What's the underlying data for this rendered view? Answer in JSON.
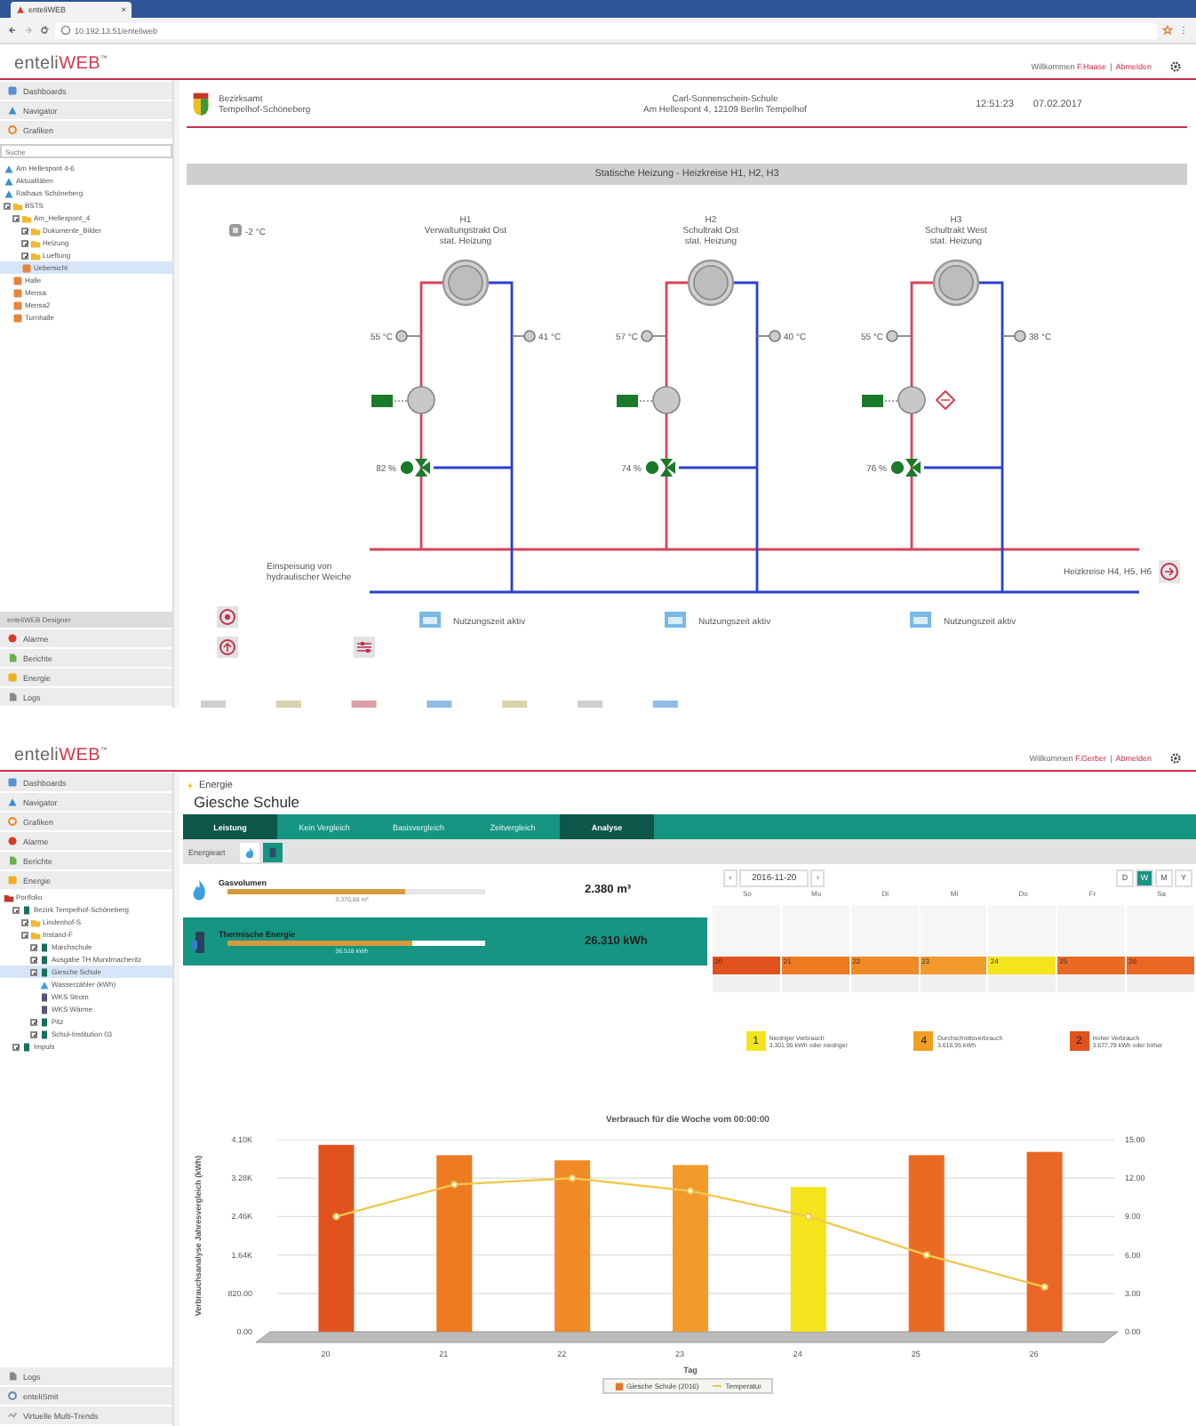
{
  "browser": {
    "tab_title": "enteliWEB",
    "tab_close": "×",
    "url": "10.192.13.51/enteliweb"
  },
  "top_app": {
    "logo": {
      "brand": "enteli",
      "accent": "WEB",
      "mark": "™"
    },
    "user_bar": {
      "greeting": "Willkommen",
      "user": "F.Haase",
      "separator": "|",
      "logout": "Abmelden"
    },
    "sidebar": {
      "nav": [
        {
          "label": "Dashboards",
          "kind": "dashboards"
        },
        {
          "label": "Navigator",
          "kind": "navigator"
        },
        {
          "label": "Grafiken",
          "kind": "graphics"
        }
      ],
      "search": {
        "placeholder": "Suche"
      },
      "tree": [
        {
          "label": "Am Hellespont 4-6",
          "kind": "site",
          "selected": false
        },
        {
          "label": "Aktualitäten",
          "kind": "site",
          "selected": false
        },
        {
          "label": "Rathaus Schöneberg",
          "kind": "site",
          "selected": false
        },
        {
          "label": "BSTS",
          "kind": "folder",
          "expanded": true,
          "selected": false,
          "children": [
            {
              "label": "Am_Hellespont_4",
              "kind": "folder",
              "expanded": true,
              "selected": false,
              "children": [
                {
                  "label": "Dokumente_Bilder",
                  "kind": "folder",
                  "expanded": false,
                  "selected": false
                },
                {
                  "label": "Heizung",
                  "kind": "folder",
                  "expanded": false,
                  "selected": false
                },
                {
                  "label": "Lueftung",
                  "kind": "folder",
                  "expanded": false,
                  "selected": false
                },
                {
                  "label": "Uebersicht",
                  "kind": "graphic",
                  "selected": true
                }
              ]
            },
            {
              "label": "Halle",
              "kind": "graphic",
              "selected": false
            },
            {
              "label": "Mensa",
              "kind": "graphic",
              "selected": false
            },
            {
              "label": "Mensa2",
              "kind": "graphic",
              "selected": false
            },
            {
              "label": "Turnhalle",
              "kind": "graphic",
              "selected": false
            }
          ]
        }
      ],
      "bottom_header": "enteliWEB Designer",
      "bottom_nav": [
        {
          "label": "Alarme",
          "kind": "alarms"
        },
        {
          "label": "Berichte",
          "kind": "reports"
        },
        {
          "label": "Energie",
          "kind": "energy"
        },
        {
          "label": "Logs",
          "kind": "logs"
        }
      ]
    },
    "site_header": {
      "authority": [
        "Bezirksamt",
        "Tempelhof-Schöneberg"
      ],
      "school": "Carl-Sonnenschein-Schule",
      "address": "Am Hellespont 4, 12109 Berlin Tempelhof",
      "time": "12:51:23",
      "date": "07.02.2017"
    },
    "diagram": {
      "title": "Statische Heizung - Heizkreise H1, H2, H3",
      "outside_temp": "-2 °C",
      "circuits": [
        {
          "id": "H1",
          "name": "Verwaltungstrakt Ost",
          "type": "stat. Heizung",
          "supply_temp": "55 °C",
          "return_temp": "41 °C",
          "valve": "82 %",
          "fault": false,
          "usage": "Nutzungszeit aktiv"
        },
        {
          "id": "H2",
          "name": "Schultrakt Ost",
          "type": "stat. Heizung",
          "supply_temp": "57 °C",
          "return_temp": "40 °C",
          "valve": "74 %",
          "fault": false,
          "usage": "Nutzungszeit aktiv"
        },
        {
          "id": "H3",
          "name": "Schultrakt West",
          "type": "stat. Heizung",
          "supply_temp": "55 °C",
          "return_temp": "38 °C",
          "valve": "76 %",
          "fault": true,
          "usage": "Nutzungszeit aktiv"
        }
      ],
      "feed_label": [
        "Einspeisung von",
        "hydraulischer Weiche"
      ],
      "next_label": "Heizkreise H4, H5, H6"
    }
  },
  "bottom_app": {
    "logo": {
      "brand": "enteli",
      "accent": "WEB",
      "mark": "™"
    },
    "user_bar": {
      "greeting": "Willkommen",
      "user": "F.Gerber",
      "separator": "|",
      "logout": "Abmelden"
    },
    "sidebar": {
      "nav": [
        {
          "label": "Dashboards",
          "kind": "dashboards"
        },
        {
          "label": "Navigator",
          "kind": "navigator"
        },
        {
          "label": "Grafiken",
          "kind": "graphics"
        },
        {
          "label": "Alarme",
          "kind": "alarms"
        },
        {
          "label": "Berichte",
          "kind": "reports"
        },
        {
          "label": "Energie",
          "kind": "energy"
        }
      ],
      "tree": [
        {
          "label": "Portfolio",
          "kind": "portfolio",
          "selected": false,
          "children": [
            {
              "label": "Bezirk Tempelhof-Schöneberg",
              "kind": "building",
              "expanded": true,
              "selected": false,
              "children": [
                {
                  "label": "Lindenhof-S",
                  "kind": "folder",
                  "expanded": false,
                  "selected": false
                },
                {
                  "label": "Instand-F",
                  "kind": "folder",
                  "expanded": true,
                  "selected": false,
                  "children": [
                    {
                      "label": "Marchschule",
                      "kind": "building",
                      "expanded": false,
                      "selected": false
                    },
                    {
                      "label": "Ausgabe TH Mundmacheritz",
                      "kind": "building",
                      "expanded": false,
                      "selected": false
                    },
                    {
                      "label": "Giesche Schule",
                      "kind": "building",
                      "expanded": true,
                      "selected": true,
                      "children": [
                        {
                          "label": "Wasserzähler (kWh)",
                          "kind": "gas",
                          "selected": false
                        },
                        {
                          "label": "WKS Strom",
                          "kind": "meter",
                          "selected": false
                        },
                        {
                          "label": "WKS Wärme",
                          "kind": "meter",
                          "selected": false
                        }
                      ]
                    },
                    {
                      "label": "Pitz",
                      "kind": "building",
                      "expanded": false,
                      "selected": false
                    },
                    {
                      "label": "Schul-Institution 03",
                      "kind": "building",
                      "expanded": false,
                      "selected": false
                    }
                  ]
                }
              ]
            },
            {
              "label": "Impuls",
              "kind": "building",
              "expanded": false,
              "selected": false
            }
          ]
        }
      ],
      "bottom_nav": [
        {
          "label": "Logs",
          "kind": "logs"
        },
        {
          "label": "enteliSmit",
          "kind": "enteli"
        },
        {
          "label": "Virtuelle Multi-Trends",
          "kind": "trends"
        }
      ]
    },
    "breadcrumb": "Energie",
    "title": "Giesche Schule",
    "tabs": [
      {
        "label": "Leistung",
        "selected": true
      },
      {
        "label": "Kein Vergleich",
        "selected": false
      },
      {
        "label": "Basisvergleich",
        "selected": false
      },
      {
        "label": "Zeitvergleich",
        "selected": false
      },
      {
        "label": "Analyse",
        "selected": true
      }
    ],
    "energy_type": {
      "label": "Energieart",
      "options": [
        {
          "kind": "gas",
          "selected": false
        },
        {
          "kind": "heat",
          "selected": true
        }
      ]
    },
    "meters": [
      {
        "kind": "gas",
        "name": "Gasvolumen",
        "level": 0.69,
        "target": "3.370,88 m³",
        "value": "2.380 m³",
        "selected": false
      },
      {
        "kind": "heat",
        "name": "Thermische Energie",
        "level": 0.72,
        "target": "36.518 kWh",
        "value": "26.310 kWh",
        "selected": true
      }
    ],
    "calendar": {
      "prev": "‹",
      "date": "2016-11-20",
      "next": "›",
      "views": [
        {
          "label": "D",
          "selected": false
        },
        {
          "label": "W",
          "selected": true
        },
        {
          "label": "M",
          "selected": false
        },
        {
          "label": "Y",
          "selected": false
        }
      ],
      "weekdays": [
        "So",
        "Mo",
        "Di",
        "Mi",
        "Do",
        "Fr",
        "Sa"
      ],
      "days": [
        {
          "day": "20",
          "color": "#e2521e"
        },
        {
          "day": "21",
          "color": "#ee7a22"
        },
        {
          "day": "22",
          "color": "#f08a26"
        },
        {
          "day": "23",
          "color": "#f29a2c"
        },
        {
          "day": "24",
          "color": "#f4e41c"
        },
        {
          "day": "25",
          "color": "#ea6a24"
        },
        {
          "day": "26",
          "color": "#ea6624"
        }
      ]
    },
    "legend": [
      {
        "number": "1",
        "color": "#f4e41c",
        "title": "Niedriger Verbrauch",
        "detail": "3.301,95 kWh oder niedriger"
      },
      {
        "number": "4",
        "color": "#f0a020",
        "title": "Durchschnittsverbrauch",
        "detail": "3.616,95 kWh"
      },
      {
        "number": "2",
        "color": "#e2521e",
        "title": "Hoher Verbrauch",
        "detail": "3.677,79 kWh oder höher"
      }
    ],
    "chart": {
      "chart_data": {
        "type": "bar",
        "title": "Verbrauch für die Woche vom 00:00:00",
        "xlabel": "Tag",
        "ylabel": "Verbrauchsanalyse Jahresvergleich (kWh)",
        "categories": [
          "20",
          "21",
          "22",
          "23",
          "24",
          "25",
          "26"
        ],
        "series": [
          {
            "name": "Giesche Schule (2016)",
            "color": "#e07a2a",
            "colors": [
              "#e2521e",
              "#ee7a22",
              "#f08a26",
              "#f29a2c",
              "#f4e41c",
              "#ea6a24",
              "#ea6624"
            ],
            "values": [
              3990,
              3770,
              3660,
              3560,
              3090,
              3770,
              3840
            ]
          },
          {
            "name": "Temperatur",
            "type": "line",
            "color": "#f0c850",
            "axis": "y2",
            "marker": "o",
            "values": [
              9,
              11.5,
              12,
              11,
              9,
              6,
              3.5
            ]
          }
        ],
        "grid": true,
        "stacked": false,
        "legend": "bottom",
        "ylim": [
          0,
          4100
        ],
        "yticks": [
          {
            "value": 0,
            "label": "0.00"
          },
          {
            "value": 820,
            "label": "820.00"
          },
          {
            "value": 1640,
            "label": "1.64K"
          },
          {
            "value": 2460,
            "label": "2.46K"
          },
          {
            "value": 3280,
            "label": "3.28K"
          },
          {
            "value": 4100,
            "label": "4.10K"
          }
        ],
        "y2lim": [
          0,
          15
        ],
        "y2ticks": [
          {
            "value": 0,
            "label": "0.00"
          },
          {
            "value": 3,
            "label": "3.00"
          },
          {
            "value": 6,
            "label": "6.00"
          },
          {
            "value": 9,
            "label": "9.00"
          },
          {
            "value": 12,
            "label": "12.00"
          },
          {
            "value": 15,
            "label": "15.00"
          }
        ]
      }
    }
  }
}
